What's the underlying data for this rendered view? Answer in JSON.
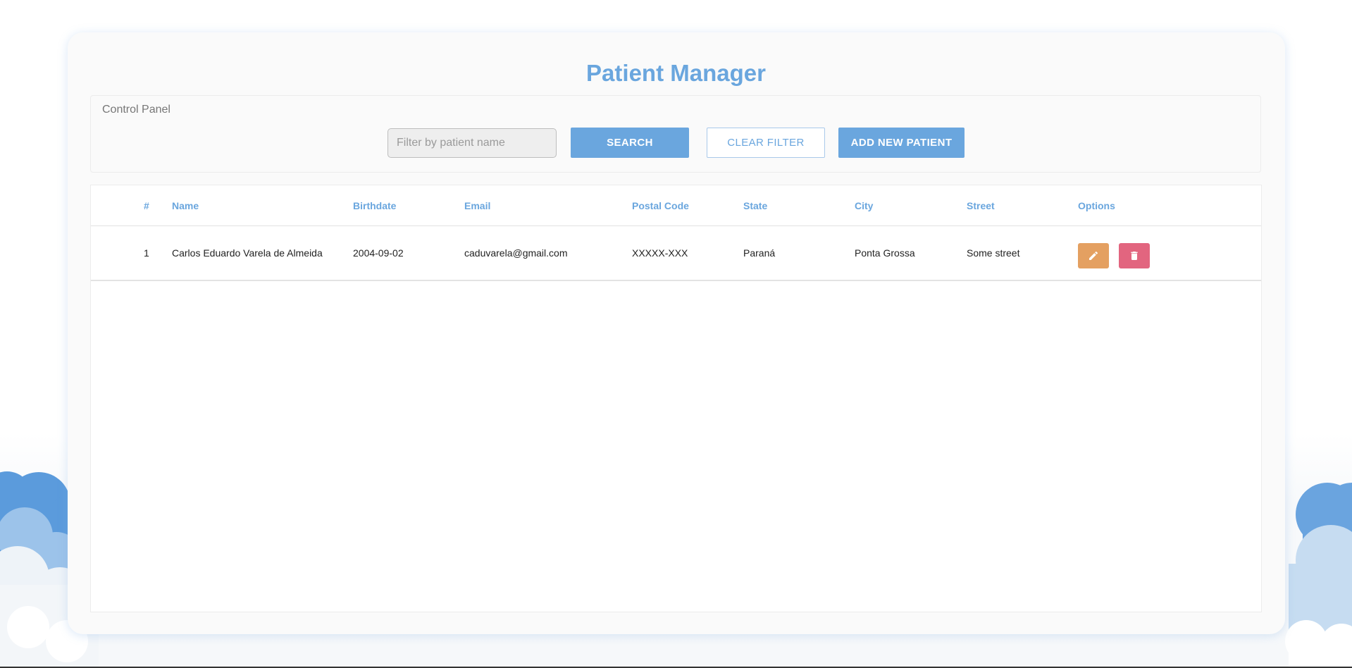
{
  "app": {
    "title": "Patient Manager"
  },
  "control_panel": {
    "label": "Control Panel",
    "search_placeholder": "Filter by patient name",
    "search_value": "",
    "search_button": "SEARCH",
    "clear_button": "CLEAR FILTER",
    "add_button": "ADD NEW PATIENT"
  },
  "table": {
    "columns": [
      "#",
      "Name",
      "Birthdate",
      "Email",
      "Postal Code",
      "State",
      "City",
      "Street",
      "Options"
    ],
    "rows": [
      {
        "index": "1",
        "name": "Carlos Eduardo Varela de Almeida",
        "birthdate": "2004-09-02",
        "email": "caduvarela@gmail.com",
        "postal_code": "XXXXX-XXX",
        "state": "Paraná",
        "city": "Ponta Grossa",
        "street": "Some street",
        "options": [
          "pencil-icon",
          "trash-icon"
        ]
      }
    ]
  },
  "colors": {
    "accent": "#6aa6de",
    "edit": "#e4a061",
    "delete": "#e2657f"
  }
}
